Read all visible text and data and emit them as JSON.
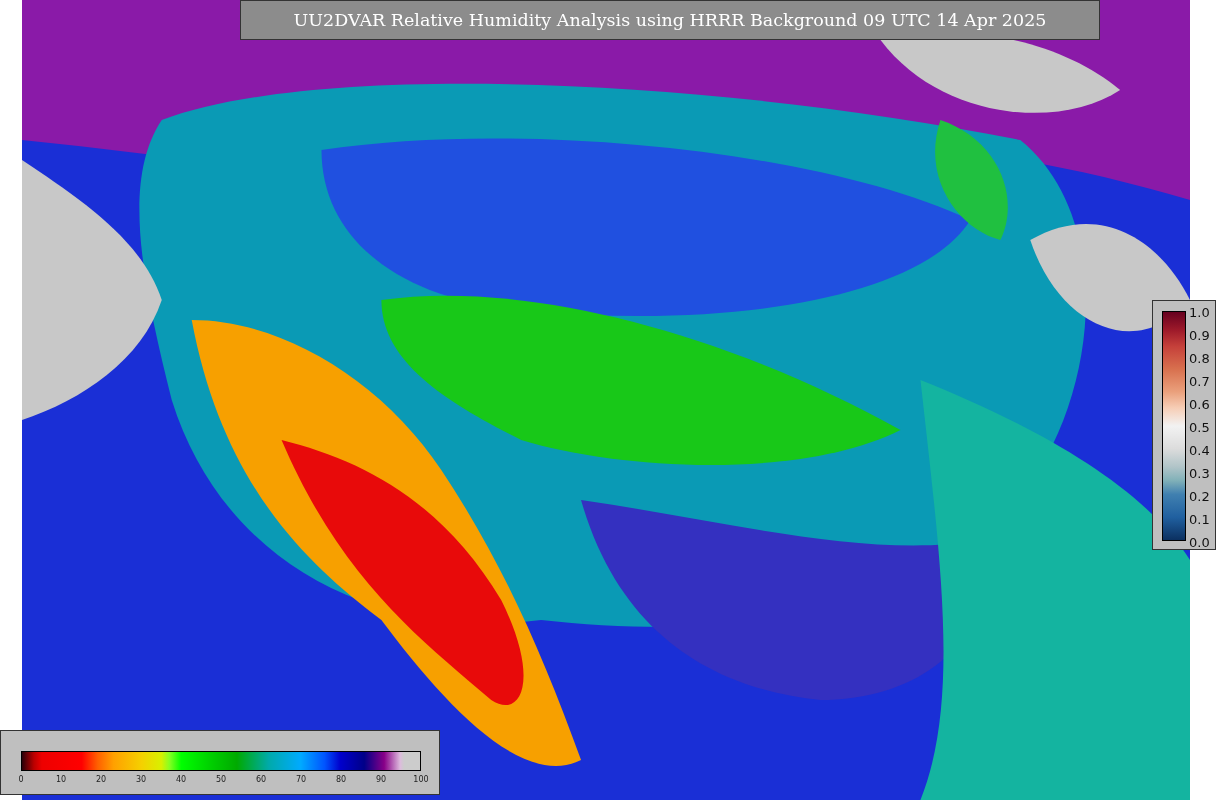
{
  "title": "UU2DVAR Relative Humidity Analysis using HRRR Background 09 UTC 14 Apr 2025",
  "colorbar_bottom": {
    "ticks": [
      "0",
      "10",
      "20",
      "30",
      "40",
      "50",
      "60",
      "70",
      "80",
      "90",
      "100"
    ]
  },
  "colorbar_right": {
    "ticks": [
      "1.0",
      "0.9",
      "0.8",
      "0.7",
      "0.6",
      "0.5",
      "0.4",
      "0.3",
      "0.2",
      "0.1",
      "0.0"
    ]
  }
}
